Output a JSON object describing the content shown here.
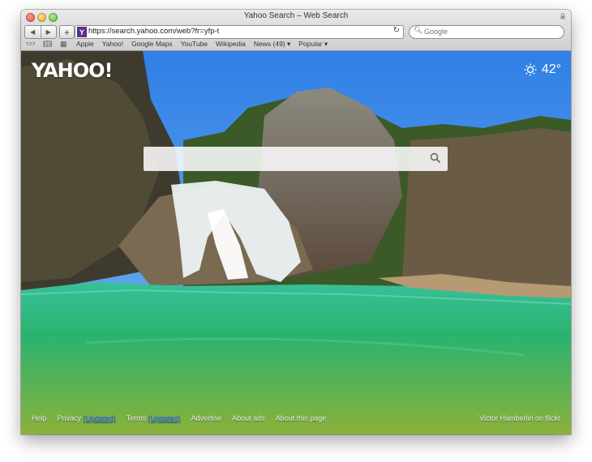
{
  "window": {
    "title": "Yahoo Search – Web Search"
  },
  "toolbar": {
    "url": "https://search.yahoo.com/web?fr=yfp-t",
    "search_placeholder": "Google"
  },
  "bookmarks": [
    "Apple",
    "Yahoo!",
    "Google Maps",
    "YouTube",
    "Wikipedia",
    "News (49) ▾",
    "Popular ▾"
  ],
  "page": {
    "logo": "YAHOO!",
    "weather": {
      "temp": "42°"
    },
    "search": {
      "value": ""
    },
    "footer": {
      "help": "Help",
      "privacy": "Privacy",
      "privacy_tag": "(Updated)",
      "terms": "Terms",
      "terms_tag": "(Updated)",
      "advertise": "Advertise",
      "about_ads": "About ads",
      "about_page": "About this page",
      "credit": "Victor Hamberlin on flickr"
    }
  },
  "colors": {
    "accent": "#5c2d91",
    "sky": "#3f8ee0",
    "water": "#2bb37c"
  }
}
